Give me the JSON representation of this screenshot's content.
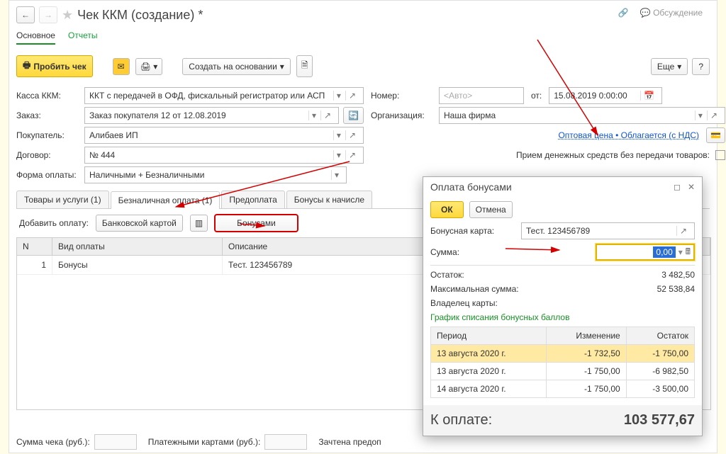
{
  "header": {
    "title": "Чек ККМ (создание) *"
  },
  "mainTabs": {
    "active": "Основное",
    "other": "Отчеты"
  },
  "toolbar": {
    "probit": "Пробить чек",
    "create_base": "Создать на основании",
    "more": "Еще",
    "help": "?"
  },
  "discuss": "Обсуждение",
  "fields": {
    "kassa_lbl": "Касса ККМ:",
    "kassa_val": "ККТ с передачей в ОФД, фискальный регистратор или АСП",
    "zakaz_lbl": "Заказ:",
    "zakaz_val": "Заказ покупателя 12 от 12.08.2019",
    "buyer_lbl": "Покупатель:",
    "buyer_val": "Алибаев ИП",
    "dogovor_lbl": "Договор:",
    "dogovor_val": "№ 444",
    "forma_lbl": "Форма оплаты:",
    "forma_val": "Наличными + Безналичными",
    "nomer_lbl": "Номер:",
    "nomer_ph": "<Авто>",
    "ot": "от:",
    "date": "15.08.2019  0:00:00",
    "org_lbl": "Организация:",
    "org_val": "Наша фирма",
    "price_link": "Оптовая цена • Облагается (с НДС)",
    "cash_no_goods": "Прием денежных средств без передачи товаров:"
  },
  "sectionTabs": [
    "Товары и услуги (1)",
    "Безналичная оплата (1)",
    "Предоплата",
    "Бонусы к начисле"
  ],
  "subbar": {
    "add": "Добавить оплату:",
    "card": "Банковской картой",
    "bonus": "Бонусами"
  },
  "payTable": {
    "cols": [
      "N",
      "Вид оплаты",
      "Описание"
    ],
    "row": {
      "n": "1",
      "type": "Бонусы",
      "desc": "Тест. 123456789"
    }
  },
  "totals": {
    "sum": "Сумма чека (руб.):",
    "cards": "Платежными картами (руб.):",
    "prepay": "Зачтена предоп"
  },
  "modal": {
    "title": "Оплата бонусами",
    "ok": "ОК",
    "cancel": "Отмена",
    "card_lbl": "Бонусная карта:",
    "card_val": "Тест. 123456789",
    "sum_lbl": "Сумма:",
    "sum_val": "0,00",
    "ostatok_lbl": "Остаток:",
    "ostatok_val": "3 482,50",
    "max_lbl": "Максимальная сумма:",
    "max_val": "52 538,84",
    "owner_lbl": "Владелец карты:",
    "schedule": "График списания бонусных баллов",
    "t_cols": [
      "Период",
      "Изменение",
      "Остаток"
    ],
    "rows": [
      {
        "p": "13 августа 2020 г.",
        "c": "-1 732,50",
        "o": "-1 750,00"
      },
      {
        "p": "13 августа 2020 г.",
        "c": "-1 750,00",
        "o": "-6 982,50"
      },
      {
        "p": "14 августа 2020 г.",
        "c": "-1 750,00",
        "o": "-3 500,00"
      }
    ],
    "topay_lbl": "К оплате:",
    "topay_val": "103 577,67"
  }
}
